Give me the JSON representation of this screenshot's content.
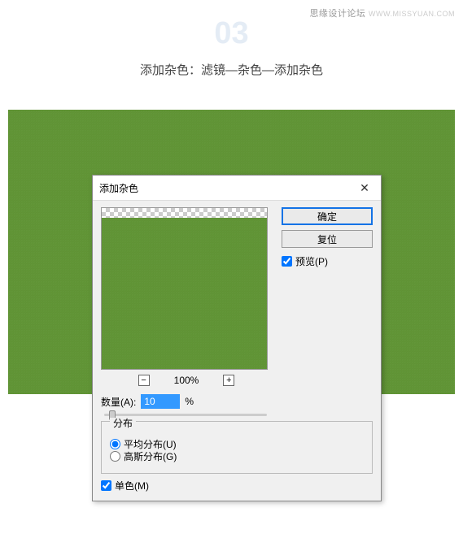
{
  "header": {
    "brand": "思缘设计论坛",
    "url": "WWW.MISSYUAN.COM"
  },
  "step": {
    "number": "03",
    "title": "添加杂色：滤镜—杂色—添加杂色"
  },
  "dialog": {
    "title": "添加杂色",
    "okLabel": "确定",
    "resetLabel": "复位",
    "previewLabel": "预览(P)",
    "previewChecked": true,
    "zoom": "100%",
    "amountLabel": "数量(A):",
    "amountValue": "10",
    "amountUnit": "%",
    "distribution": {
      "legend": "分布",
      "uniform": "平均分布(U)",
      "gaussian": "高斯分布(G)",
      "selected": "uniform"
    },
    "monochromaticLabel": "单色(M)",
    "monochromaticChecked": true
  }
}
